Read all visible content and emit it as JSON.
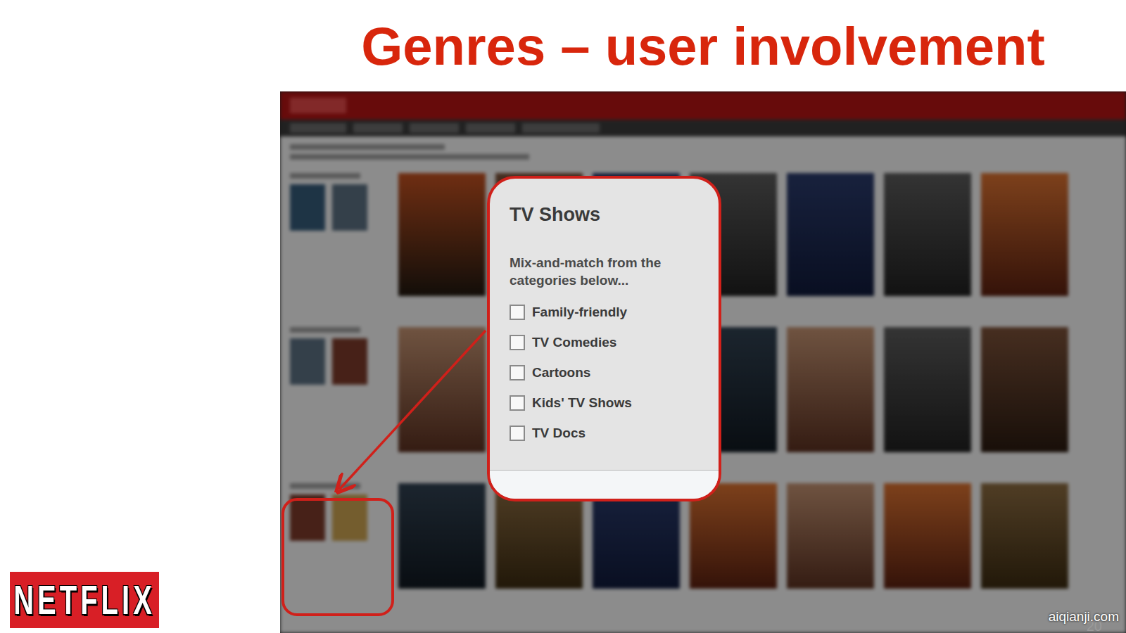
{
  "slide": {
    "title": "Genres – user involvement",
    "page_number": "20",
    "watermark": "aiqianji.com"
  },
  "logo": {
    "text": "NETFLIX"
  },
  "popup": {
    "title": "TV Shows",
    "instructions": "Mix-and-match from the categories below...",
    "categories": [
      {
        "label": "Family-friendly",
        "checked": false
      },
      {
        "label": "TV Comedies",
        "checked": false
      },
      {
        "label": "Cartoons",
        "checked": false
      },
      {
        "label": "Kids' TV Shows",
        "checked": false
      },
      {
        "label": "TV Docs",
        "checked": false
      }
    ]
  }
}
